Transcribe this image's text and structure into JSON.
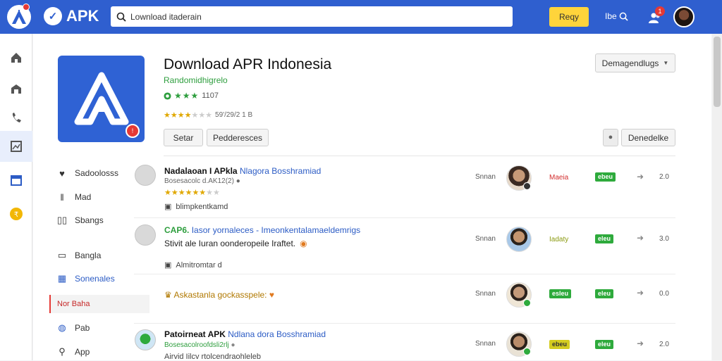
{
  "topbar": {
    "brand": "APK",
    "search_value": "Lownload itaderain",
    "primary_button": "Reqy",
    "user_text": "Ibe",
    "notification_count": "1"
  },
  "rail": [
    "home-icon",
    "store-icon",
    "phone-icon",
    "gallery-icon",
    "calendar-icon",
    "badge-icon"
  ],
  "app": {
    "title": "Download APR Indonesia",
    "subtitle": "Randomidhigrelo",
    "rating_count": "1107",
    "rating_meta": "59'/29/2 1 B",
    "star_rating": 3.5,
    "button_1": "Setar",
    "button_2": "Pedderesces",
    "dropdown": "Demagendlugs",
    "right_button": "Denedelke"
  },
  "sidebar": {
    "items": [
      {
        "label": "Sadoolosss",
        "icon": "heart-icon"
      },
      {
        "label": "Mad",
        "icon": "bar-icon"
      },
      {
        "label": "Sbangs",
        "icon": "bars-icon"
      },
      {
        "label": "Bangla",
        "icon": "image-icon"
      },
      {
        "label": "Sonenales",
        "icon": "grid-icon"
      },
      {
        "label": "Nor Baha",
        "icon": ""
      },
      {
        "label": "Pab",
        "icon": "globe-icon"
      },
      {
        "label": "App",
        "icon": "search-icon"
      }
    ]
  },
  "rows": [
    {
      "title": "Nadalaoan I APkla",
      "link": "Nlagora Bosshramiad",
      "meta": "Bosesacolc d.AK12(2)",
      "note": "blimpkentkamd",
      "col": "Snnan",
      "status": "Maeia",
      "tag": "ebeu",
      "score": "2.0"
    },
    {
      "title": "CAP6.",
      "link": "Iasor yornaleces - Imeonkentalamaeldemrigs",
      "meta": "",
      "note": "Stivit ale Iuran oonderopeile Iraftet.",
      "note2": "Almitromtar d",
      "col": "Snnan",
      "status": "Iadaty",
      "tag": "eleu",
      "score": "3.0"
    },
    {
      "title": "Askastanla gockasspele:",
      "link": "",
      "meta": "",
      "note": "",
      "col": "Snnan",
      "status": "esleu",
      "tag": "eleu",
      "score": "0.0"
    },
    {
      "title": "Patoirneat APK",
      "link": "Ndlana dora Bosshramiad",
      "meta": "Bosesacolroofdsli2rlj",
      "note": "Airvid Iilcv rtolcendraohleleb",
      "col": "Snnan",
      "status": "ebeu",
      "tag": "eleu",
      "score": "2.0"
    }
  ],
  "colors": {
    "topbar": "#2f5fcf",
    "accent_green": "#2eaa3c",
    "accent_red": "#e53935",
    "button_yellow": "#ffd43b"
  }
}
